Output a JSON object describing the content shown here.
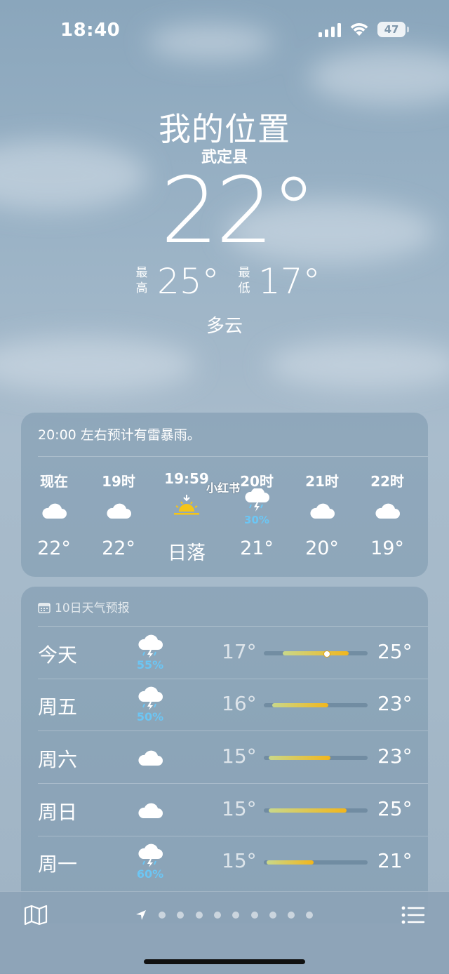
{
  "status_bar": {
    "time": "18:40",
    "battery": "47",
    "signal_icon": "signal-bars-icon",
    "wifi_icon": "wifi-icon"
  },
  "location": {
    "title": "我的位置",
    "subtitle": "武定县"
  },
  "current": {
    "temperature": "22°",
    "high_caption_1": "最",
    "high_caption_2": "高",
    "high": "25°",
    "low_caption_1": "最",
    "low_caption_2": "低",
    "low": "17°",
    "condition": "多云"
  },
  "hourly_card": {
    "alert": "20:00 左右预计有雷暴雨。",
    "hours": [
      {
        "label": "现在",
        "icon": "cloud-icon",
        "value": "22°"
      },
      {
        "label": "19时",
        "icon": "cloud-icon",
        "value": "22°"
      },
      {
        "label": "19:59",
        "icon": "sunset-icon",
        "value": "日落"
      },
      {
        "label": "20时",
        "icon": "thunderstorm-icon",
        "precip": "30%",
        "value": "21°"
      },
      {
        "label": "21时",
        "icon": "cloud-icon",
        "value": "20°"
      },
      {
        "label": "22时",
        "icon": "cloud-icon",
        "value": "19°"
      }
    ]
  },
  "watermark": "小红书",
  "daily_card": {
    "header": "10日天气预报",
    "header_icon": "calendar-icon",
    "days": [
      {
        "day": "今天",
        "icon": "thunderstorm-icon",
        "precip": "55%",
        "low": "17°",
        "high": "25°",
        "range_start": 0.18,
        "range_end": 0.82,
        "current_marker": 0.6
      },
      {
        "day": "周五",
        "icon": "thunderstorm-icon",
        "precip": "50%",
        "low": "16°",
        "high": "23°",
        "range_start": 0.08,
        "range_end": 0.62
      },
      {
        "day": "周六",
        "icon": "cloud-icon",
        "low": "15°",
        "high": "23°",
        "range_start": 0.05,
        "range_end": 0.64
      },
      {
        "day": "周日",
        "icon": "cloud-icon",
        "low": "15°",
        "high": "25°",
        "range_start": 0.05,
        "range_end": 0.8
      },
      {
        "day": "周一",
        "icon": "thunderstorm-icon",
        "precip": "60%",
        "low": "15°",
        "high": "21°",
        "range_start": 0.03,
        "range_end": 0.48
      }
    ]
  },
  "bottom_bar": {
    "map_icon": "map-icon",
    "location_icon": "location-arrow-icon",
    "page_dots": 9,
    "list_icon": "list-icon"
  },
  "colors": {
    "precip": "#6cc6f4",
    "sun": "#f5c518",
    "bar_cool": "#c9d88a",
    "bar_warm": "#f2b61c"
  }
}
